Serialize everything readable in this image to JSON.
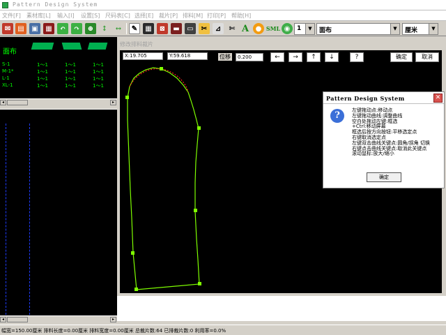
{
  "window": {
    "title": "Pattern Design System"
  },
  "menu": [
    "文件[F]",
    "素材库[L]",
    "输入[I]",
    "设置[S]",
    "尺码表[C]",
    "选择[E]",
    "裁片[P]",
    "排料[M]",
    "打印[P]",
    "帮助[H]"
  ],
  "toolbar": {
    "icons": [
      "mail-icon",
      "book-icon",
      "save-icon",
      "print-icon",
      "undo-icon",
      "redo-icon",
      "zoom-icon",
      "vertical-arrow-icon",
      "horizontal-arrow-icon",
      "pen-icon",
      "grid-icon",
      "split-icon",
      "bookmark-icon",
      "board-icon",
      "cut-icon",
      "ruler-icon",
      "scissors-icon",
      "letter-a-icon",
      "palette-icon",
      "sml-icon",
      "globe-icon"
    ],
    "letter_a": "A",
    "sml": "SML",
    "layer_value": "1",
    "fabric_value": "面布",
    "unit_value": "厘米"
  },
  "size_panel": {
    "fabric_label": "面布",
    "rows": [
      {
        "size": "S-1",
        "c1": "1～1",
        "c2": "1～1",
        "c3": "1～1"
      },
      {
        "size": "M-1*",
        "c1": "1～1",
        "c2": "1～1",
        "c3": "1～1"
      },
      {
        "size": "L-1",
        "c1": "1～1",
        "c2": "1～1",
        "c3": "1～1"
      },
      {
        "size": "XL-1",
        "c1": "1～1",
        "c2": "1～1",
        "c3": "1～1"
      }
    ]
  },
  "editor": {
    "title": "修改排料裁片",
    "x_coord": "X:19.705",
    "y_coord": "Y:59.618",
    "move_label": "位移",
    "move_value": "0.200",
    "arrows": [
      "←",
      "→",
      "↑",
      "↓"
    ],
    "help": "?",
    "ok_label": "确定",
    "cancel_label": "取消"
  },
  "dialog": {
    "title": "Pattern Design System",
    "icon": "?",
    "close": "✕",
    "lines": [
      "左键拖动点:移动点",
      "左键拖动曲线:调整曲线",
      "空白处拖动左键:框选",
      "  +Ctrl:移动屏幕",
      "框选后按方向按钮:平移选定点",
      "  右键取消选定点",
      "左键双击曲线关键点:圆角/拐角 切换",
      "右键点击曲线关键点:取消此关键点",
      "滚动鼠标:放大/缩小"
    ],
    "ok_label": "确定"
  },
  "status": {
    "text": "幅宽=150.00厘米  排料长度=0.00厘米  排料宽度=0.00厘米  总裁片数:64  已排裁片数:0  利用率=0.0%"
  },
  "colors": {
    "accent_green": "#00ff00",
    "piece_line": "#7fff00",
    "curve_red": "#ff2020",
    "guide_blue": "#1e3cff"
  }
}
